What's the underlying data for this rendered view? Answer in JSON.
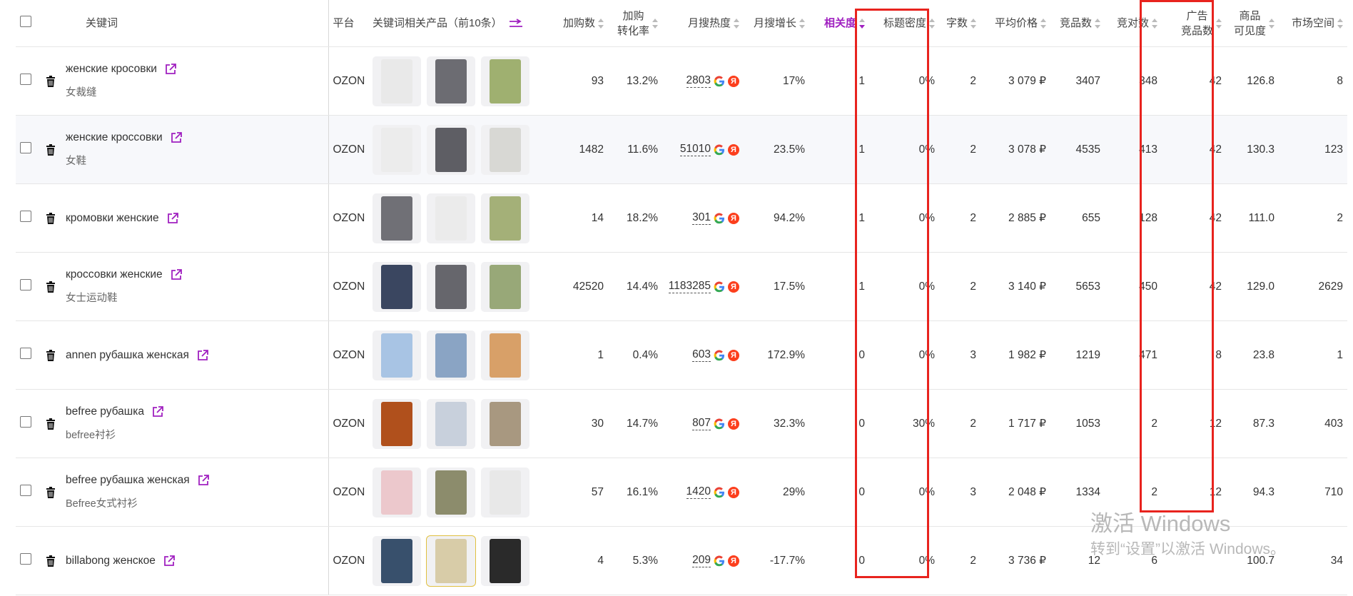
{
  "header": {
    "keyword": "关键词",
    "platform": "平台",
    "related_products": "关键词相关产品（前10条）",
    "cart_adds": "加购数",
    "cart_conv_1": "加购",
    "cart_conv_2": "转化率",
    "monthly_heat": "月搜热度",
    "monthly_growth": "月搜增长",
    "relevance": "相关度",
    "title_density": "标题密度",
    "word_count": "字数",
    "avg_price": "平均价格",
    "competing_products": "竞品数",
    "competitors": "竞对数",
    "ad_comp_1": "广告",
    "ad_comp_2": "竞品数",
    "visibility_1": "商品",
    "visibility_2": "可见度",
    "market_space": "市场空间"
  },
  "rows": [
    {
      "keyword": "женские кросовки",
      "sub": "女裁缝",
      "platform": "OZON",
      "cart": "93",
      "conv": "13.2%",
      "heat": "2803",
      "growth": "17%",
      "relevance": "1",
      "density": "0%",
      "words": "2",
      "price": "3 079 ₽",
      "comp": "3407",
      "rivals": "348",
      "ad": "42",
      "visibility": "126.8",
      "market": "8",
      "prods": [
        "#e9e9e9",
        "#6c6c72",
        "#9fb070"
      ]
    },
    {
      "keyword": "женские кроссовки",
      "sub": "女鞋",
      "platform": "OZON",
      "cart": "1482",
      "conv": "11.6%",
      "heat": "51010",
      "growth": "23.5%",
      "relevance": "1",
      "density": "0%",
      "words": "2",
      "price": "3 078 ₽",
      "comp": "4535",
      "rivals": "413",
      "ad": "42",
      "visibility": "130.3",
      "market": "123",
      "prods": [
        "#ececec",
        "#5e5e64",
        "#d8d8d4"
      ]
    },
    {
      "keyword": "кромовки женские",
      "sub": "",
      "platform": "OZON",
      "cart": "14",
      "conv": "18.2%",
      "heat": "301",
      "growth": "94.2%",
      "relevance": "1",
      "density": "0%",
      "words": "2",
      "price": "2 885 ₽",
      "comp": "655",
      "rivals": "128",
      "ad": "42",
      "visibility": "111.0",
      "market": "2",
      "prods": [
        "#707076",
        "#ebebeb",
        "#a4b078"
      ]
    },
    {
      "keyword": "кроссовки женские",
      "sub": "女士运动鞋",
      "platform": "OZON",
      "cart": "42520",
      "conv": "14.4%",
      "heat": "1183285",
      "growth": "17.5%",
      "relevance": "1",
      "density": "0%",
      "words": "2",
      "price": "3 140 ₽",
      "comp": "5653",
      "rivals": "450",
      "ad": "42",
      "visibility": "129.0",
      "market": "2629",
      "prods": [
        "#3a4660",
        "#66666c",
        "#98a878"
      ]
    },
    {
      "keyword": "annen рубашка женская",
      "sub": "",
      "platform": "OZON",
      "cart": "1",
      "conv": "0.4%",
      "heat": "603",
      "growth": "172.9%",
      "relevance": "0",
      "density": "0%",
      "words": "3",
      "price": "1 982 ₽",
      "comp": "1219",
      "rivals": "471",
      "ad": "8",
      "visibility": "23.8",
      "market": "1",
      "prods": [
        "#a8c4e4",
        "#8aa4c4",
        "#d8a068"
      ]
    },
    {
      "keyword": "befree рубашка",
      "sub": "befree衬衫",
      "platform": "OZON",
      "cart": "30",
      "conv": "14.7%",
      "heat": "807",
      "growth": "32.3%",
      "relevance": "0",
      "density": "30%",
      "words": "2",
      "price": "1 717 ₽",
      "comp": "1053",
      "rivals": "2",
      "ad": "12",
      "visibility": "87.3",
      "market": "403",
      "prods": [
        "#b0501c",
        "#c8d0dc",
        "#a89880"
      ]
    },
    {
      "keyword": "befree рубашка женская",
      "sub": "Befree女式衬衫",
      "platform": "OZON",
      "cart": "57",
      "conv": "16.1%",
      "heat": "1420",
      "growth": "29%",
      "relevance": "0",
      "density": "0%",
      "words": "3",
      "price": "2 048 ₽",
      "comp": "1334",
      "rivals": "2",
      "ad": "12",
      "visibility": "94.3",
      "market": "710",
      "prods": [
        "#ecc8cc",
        "#8c8c6c",
        "#e8e8e8"
      ]
    },
    {
      "keyword": "billabong женское",
      "sub": "",
      "platform": "OZON",
      "cart": "4",
      "conv": "5.3%",
      "heat": "209",
      "growth": "-17.7%",
      "relevance": "0",
      "density": "0%",
      "words": "2",
      "price": "3 736 ₽",
      "comp": "12",
      "rivals": "6",
      "ad": "",
      "visibility": "100.7",
      "market": "34",
      "prods": [
        "#38506c",
        "#d8cca8",
        "#2a2a2a"
      ]
    }
  ],
  "watermark": {
    "line1": "激活 Windows",
    "line2": "转到“设置”以激活 Windows。"
  },
  "colors": {
    "accent": "#a020c0",
    "highlight_box": "#e8231e",
    "yandex": "#fc3f1d"
  }
}
